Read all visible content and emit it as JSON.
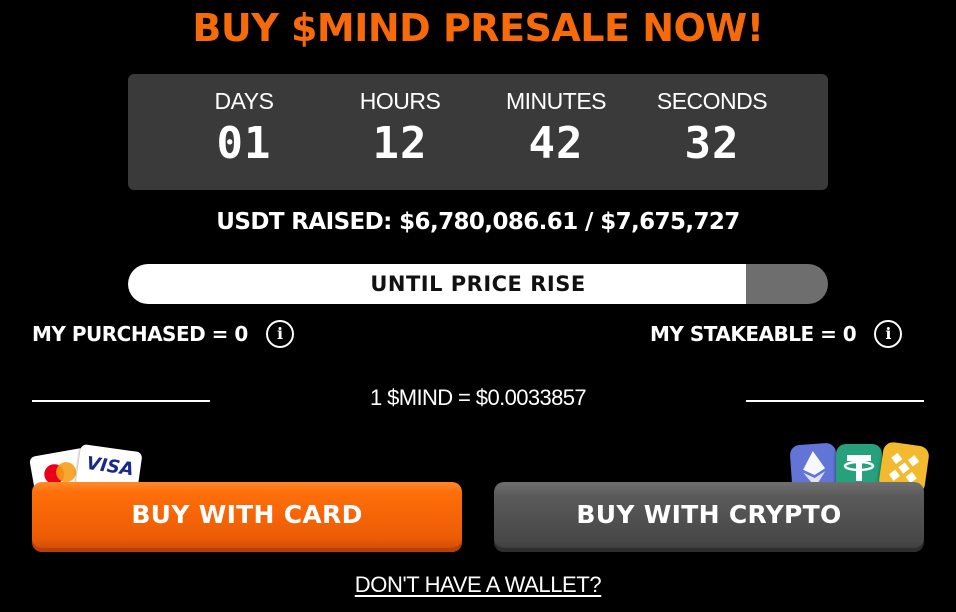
{
  "header": {
    "title": "BUY $MIND PRESALE NOW!"
  },
  "countdown": {
    "units": [
      {
        "label": "DAYS",
        "value": "01"
      },
      {
        "label": "HOURS",
        "value": "12"
      },
      {
        "label": "MINUTES",
        "value": "42"
      },
      {
        "label": "SECONDS",
        "value": "32"
      }
    ]
  },
  "raised": {
    "text": "USDT RAISED: $6,780,086.61 / $7,675,727"
  },
  "progress": {
    "label": "UNTIL PRICE RISE",
    "fraction": 0.883
  },
  "stats": {
    "purchased": "MY PURCHASED = 0",
    "stakeable": "MY STAKEABLE = 0",
    "info_icon": "i"
  },
  "rate": {
    "text": "1 $MIND = $0.0033857"
  },
  "payment_icons": {
    "card": [
      "mastercard-icon",
      "visa-icon"
    ],
    "card_brand": "VISA",
    "crypto": [
      "ethereum-icon",
      "tether-icon",
      "bnb-icon"
    ]
  },
  "buttons": {
    "card_label": "BUY WITH CARD",
    "crypto_label": "BUY WITH CRYPTO"
  },
  "links": {
    "wallet": "DON'T HAVE A WALLET?"
  },
  "colors": {
    "accent": "#f76a0a",
    "panel": "#3a3a3a",
    "card_button": "#ff6e0a",
    "crypto_button": "#4a4a4a",
    "progress_track": "#6e6e6e"
  }
}
